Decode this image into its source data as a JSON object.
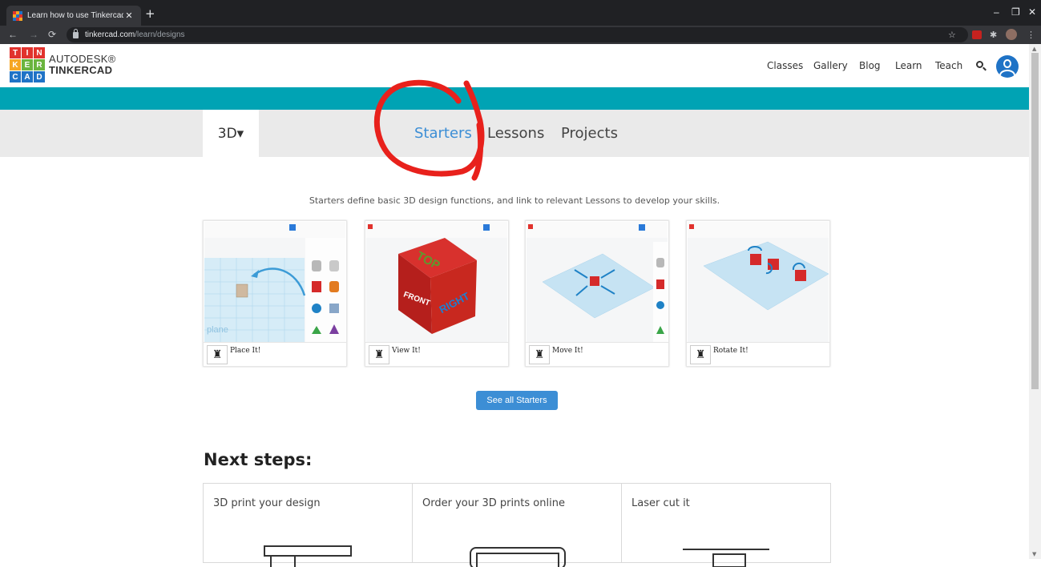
{
  "browser": {
    "tab_title": "Learn how to use Tinkercad | Tink",
    "tab_close": "✕",
    "new_tab": "+",
    "url_host": "tinkercad.com",
    "url_path": "/learn/designs",
    "window_controls": [
      "–",
      "❐",
      "✕"
    ]
  },
  "header": {
    "logo_letters": [
      "T",
      "I",
      "N",
      "K",
      "E",
      "R",
      "C",
      "A",
      "D"
    ],
    "brand_top": "AUTODESK®",
    "brand_bottom": "TINKERCAD",
    "nav": [
      "Classes",
      "Gallery",
      "Blog",
      "Learn",
      "Teach"
    ]
  },
  "subnav": {
    "dropdown": "3D▾",
    "tabs": [
      "Starters",
      "Lessons",
      "Projects"
    ],
    "active": "Starters"
  },
  "intro": "Starters define basic 3D design functions, and link to relevant Lessons to develop your skills.",
  "cards": [
    {
      "label": "Place It!"
    },
    {
      "label": "View It!"
    },
    {
      "label": "Move It!"
    },
    {
      "label": "Rotate It!"
    }
  ],
  "cube_text": {
    "top": "TOP",
    "front": "FRONT",
    "right": "RIGHT"
  },
  "see_all": "See all Starters",
  "next_steps": {
    "title": "Next steps:",
    "items": [
      "3D print your design",
      "Order your 3D prints online",
      "Laser cut it"
    ]
  },
  "colors": {
    "teal": "#00a3b4",
    "accent": "#3c8ed5",
    "annotation_red": "#e8211c"
  }
}
